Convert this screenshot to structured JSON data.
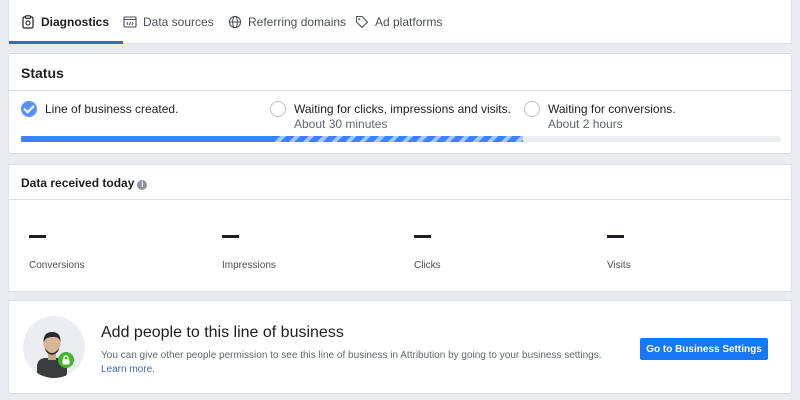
{
  "tabs": [
    {
      "label": "Diagnostics",
      "icon": "diagnostics-icon",
      "active": true
    },
    {
      "label": "Data sources",
      "icon": "code-window-icon"
    },
    {
      "label": "Referring domains",
      "icon": "globe-icon"
    },
    {
      "label": "Ad platforms",
      "icon": "tag-icon"
    }
  ],
  "status": {
    "title": "Status",
    "steps": [
      {
        "label": "Line of business created.",
        "sub": "",
        "done": true
      },
      {
        "label": "Waiting for clicks, impressions and visits.",
        "sub": "About 30 minutes",
        "done": false
      },
      {
        "label": "Waiting for conversions.",
        "sub": "About 2 hours",
        "done": false
      }
    ],
    "progress_complete": 0.33,
    "progress_in_progress": 0.66
  },
  "data_today": {
    "title": "Data received today",
    "info_icon": "info-icon",
    "metrics": [
      {
        "label": "Conversions",
        "value": "—"
      },
      {
        "label": "Impressions",
        "value": "—"
      },
      {
        "label": "Clicks",
        "value": "—"
      },
      {
        "label": "Visits",
        "value": "—"
      }
    ]
  },
  "people": {
    "title": "Add people to this line of business",
    "description": "You can give other people permission to see this line of business in Attribution by going to your business settings.",
    "link": "Learn more.",
    "button": "Go to Business Settings"
  },
  "colors": {
    "accent": "#4267b2",
    "progress": "#4080ff",
    "button": "#1877f2",
    "lock_badge": "#42b72a"
  }
}
